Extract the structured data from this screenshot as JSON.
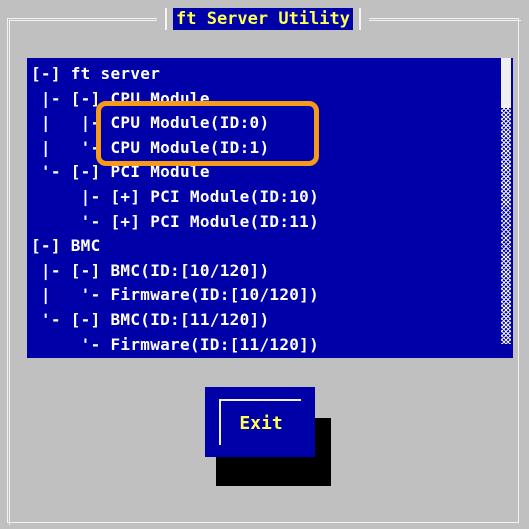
{
  "window": {
    "title": "ft Server Utility"
  },
  "tree": {
    "rows": [
      "[-] ft server",
      " |- [-] CPU Module",
      " |   |- CPU Module(ID:0)",
      " |   '- CPU Module(ID:1)",
      " '- [-] PCI Module",
      "     |- [+] PCI Module(ID:10)",
      "     '- [+] PCI Module(ID:11)",
      "[-] BMC",
      " |- [-] BMC(ID:[10/120])",
      " |   '- Firmware(ID:[10/120])",
      " '- [-] BMC(ID:[11/120])",
      "     '- Firmware(ID:[11/120])"
    ],
    "highlighted_items": [
      "CPU Module(ID:0)",
      "CPU Module(ID:1)"
    ]
  },
  "buttons": {
    "exit_label": "Exit"
  },
  "colors": {
    "panel_blue": "#0000a8",
    "title_yellow": "#ffff54",
    "highlight_orange": "#f79a18",
    "background_gray": "#c0c0c0"
  }
}
